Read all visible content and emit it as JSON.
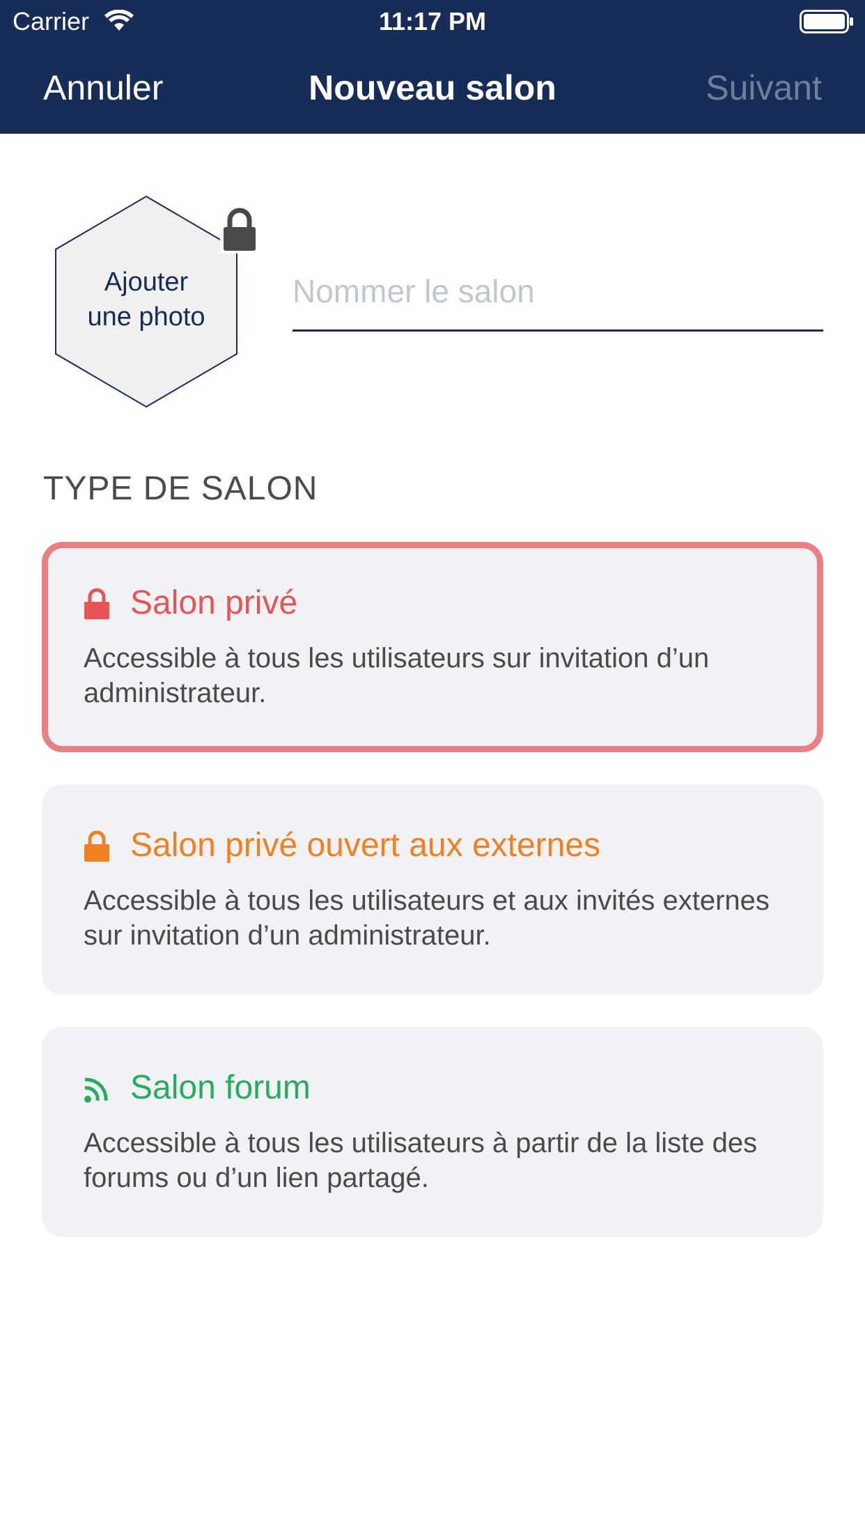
{
  "status_bar": {
    "carrier": "Carrier",
    "time": "11:17 PM"
  },
  "nav": {
    "cancel_label": "Annuler",
    "title": "Nouveau salon",
    "next_label": "Suivant"
  },
  "photo": {
    "label": "Ajouter\nune photo"
  },
  "name_field": {
    "value": "",
    "placeholder": "Nommer le salon"
  },
  "section": {
    "title": "TYPE DE SALON"
  },
  "room_types": [
    {
      "title": "Salon privé",
      "description": "Accessible à tous les utilisateurs sur invitation d’un administrateur.",
      "icon": "lock-icon",
      "color": "#e85456",
      "selected": true
    },
    {
      "title": "Salon privé ouvert aux externes",
      "description": "Accessible à tous les utilisateurs et aux invités externes sur invitation d’un administrateur.",
      "icon": "lock-icon",
      "color": "#f08020",
      "selected": false
    },
    {
      "title": "Salon forum",
      "description": "Accessible à tous les utilisateurs à partir de la liste des forums ou d’un lien partagé.",
      "icon": "rss-icon",
      "color": "#27ab5c",
      "selected": false
    }
  ],
  "colors": {
    "header_bg": "#172c56",
    "selected_border": "#e98083",
    "card_bg": "#f0f2f5",
    "disabled_nav": "#6e7f9e"
  }
}
